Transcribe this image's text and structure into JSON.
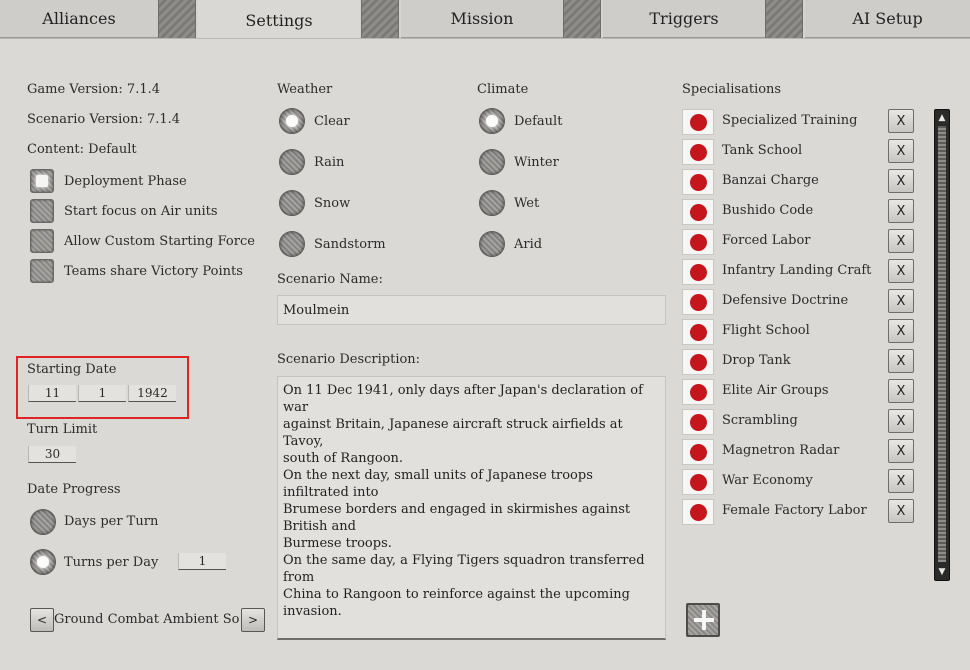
{
  "tabs": [
    "Alliances",
    "Settings",
    "Mission",
    "Triggers",
    "AI Setup"
  ],
  "active_tab": "Settings",
  "info": {
    "game_version": "Game Version: 7.1.4",
    "scenario_version": "Scenario Version: 7.1.4",
    "content": "Content: Default"
  },
  "options": [
    {
      "label": "Deployment Phase",
      "checked": true
    },
    {
      "label": "Start focus on Air units",
      "checked": false
    },
    {
      "label": "Allow Custom Starting Force",
      "checked": false
    },
    {
      "label": "Teams share Victory Points",
      "checked": false
    }
  ],
  "starting_date": {
    "label": "Starting Date",
    "day": "11",
    "month": "1",
    "year": "1942"
  },
  "turn_limit": {
    "label": "Turn Limit",
    "value": "30"
  },
  "date_progress": {
    "label": "Date Progress",
    "options": [
      {
        "label": "Days per Turn",
        "selected": false
      },
      {
        "label": "Turns per Day",
        "selected": true,
        "value": "1"
      }
    ]
  },
  "ambient_sound": {
    "label": "Ground Combat Ambient Sound",
    "prev": "<",
    "next": ">"
  },
  "weather": {
    "label": "Weather",
    "options": [
      {
        "label": "Clear",
        "selected": true
      },
      {
        "label": "Rain",
        "selected": false
      },
      {
        "label": "Snow",
        "selected": false
      },
      {
        "label": "Sandstorm",
        "selected": false
      }
    ]
  },
  "climate": {
    "label": "Climate",
    "options": [
      {
        "label": "Default",
        "selected": true
      },
      {
        "label": "Winter",
        "selected": false
      },
      {
        "label": "Wet",
        "selected": false
      },
      {
        "label": "Arid",
        "selected": false
      }
    ]
  },
  "scenario_name": {
    "label": "Scenario Name:",
    "value": "Moulmein"
  },
  "scenario_description": {
    "label": "Scenario Description:",
    "lines": [
      "On 11 Dec 1941, only days after Japan's declaration of war",
      "against Britain, Japanese aircraft struck airfields at Tavoy,",
      "south of Rangoon.",
      "On the next day, small units of Japanese troops infiltrated into",
      "Brumese borders and engaged in skirmishes against British and",
      "Burmese troops.",
      "On the same day, a Flying Tigers squadron transferred from",
      "China to Rangoon to reinforce against the upcoming invasion."
    ]
  },
  "specialisations": {
    "label": "Specialisations",
    "remove_label": "X",
    "flag_color": "#c4161c",
    "items": [
      "Specialized Training",
      "Tank School",
      "Banzai Charge",
      "Bushido Code",
      "Forced Labor",
      "Infantry Landing Craft",
      "Defensive Doctrine",
      "Flight School",
      "Drop Tank",
      "Elite Air Groups",
      "Scrambling",
      "Magnetron Radar",
      "War Economy",
      "Female Factory Labor"
    ]
  },
  "scrollbar": {
    "up": "▲",
    "down": "▼"
  },
  "highlight_color": "#e02424"
}
